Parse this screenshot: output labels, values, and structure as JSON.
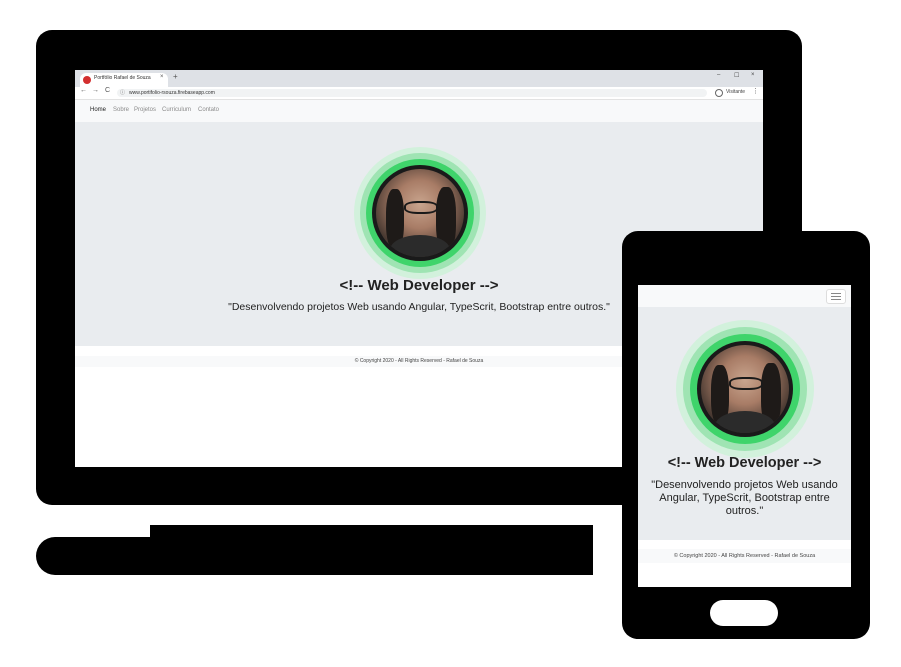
{
  "browser": {
    "tab_title": "Portfólio Rafael de Souza",
    "tab_close": "×",
    "new_tab": "+",
    "url": "www.portifolio-rsouza.firebaseapp.com",
    "profile_label": "Visitante",
    "window_controls": {
      "minimize": "–",
      "maximize": "☐",
      "close": "×"
    },
    "nav": {
      "back": "←",
      "forward": "→",
      "reload": "C"
    },
    "menu": "⋮"
  },
  "site": {
    "nav_items": [
      "Home",
      "Sobre",
      "Projetos",
      "Curriculum",
      "Contato"
    ],
    "headline": "<!-- Web Developer -->",
    "tagline": "\"Desenvolvendo projetos Web usando Angular, TypeScrit, Bootstrap entre outros.\"",
    "footer": "© Copyright 2020 - All Rights Reserved - Rafael de Souza"
  },
  "colors": {
    "ring_outer": "#c8efd4",
    "ring_mid": "#8fe0a8",
    "ring_inner": "#2ecc59",
    "hero_bg": "#e9ecef"
  }
}
